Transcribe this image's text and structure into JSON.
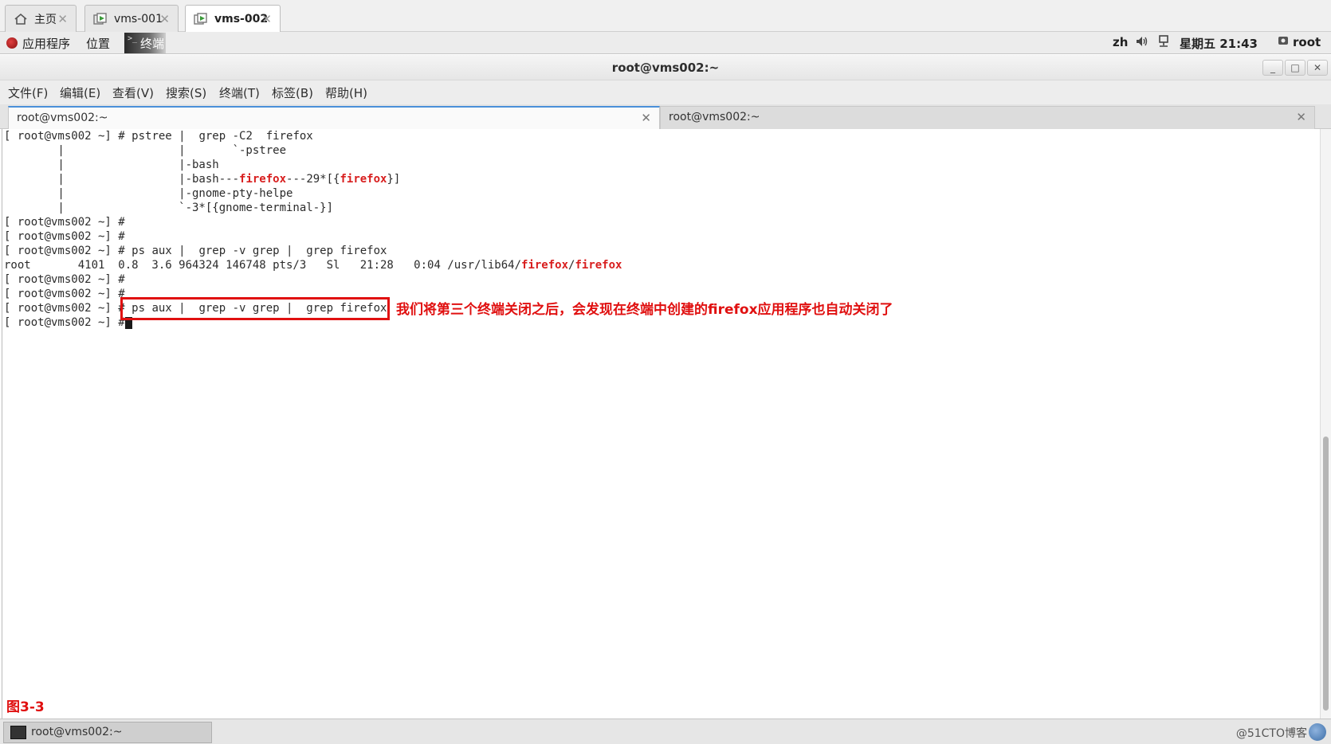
{
  "vm_tabs": [
    {
      "label": "主页",
      "icon": "home-icon",
      "active": false
    },
    {
      "label": "vms-001",
      "icon": "vm-icon",
      "active": false
    },
    {
      "label": "vms-002",
      "icon": "vm-icon",
      "active": true
    }
  ],
  "panel": {
    "applications": "应用程序",
    "places": "位置",
    "terminal": "终端",
    "input_method": "zh",
    "clock": "星期五 21:43",
    "user": "root"
  },
  "window": {
    "title": "root@vms002:~",
    "minimize": "_",
    "maximize": "□",
    "close": "✕"
  },
  "menu": [
    "文件(F)",
    "编辑(E)",
    "查看(V)",
    "搜索(S)",
    "终端(T)",
    "标签(B)",
    "帮助(H)"
  ],
  "terminal_tabs": [
    {
      "label": "root@vms002:~",
      "active": true
    },
    {
      "label": "root@vms002:~",
      "active": false
    }
  ],
  "terminal": {
    "prompt": "[ root@vms002 ~] # ",
    "lines": {
      "l1_cmd": "pstree |  grep -C2  firefox",
      "l2": "        |                 |       `-pstree",
      "l3": "        |                 |-bash",
      "l4_pre": "        |                 |-bash---",
      "l4_ff1": "firefox",
      "l4_mid": "---29*[{",
      "l4_ff2": "firefox",
      "l4_end": "}]",
      "l5": "        |                 |-gnome-pty-helpe",
      "l6": "        |                 `-3*[{gnome-terminal-}]",
      "l9_cmd": "ps aux |  grep -v grep |  grep firefox",
      "l10_pre": "root       4101  0.8  3.6 964324 146748 pts/3   Sl   21:28   0:04 /usr/lib64/",
      "l10_ff1": "firefox",
      "l10_sep": "/",
      "l10_ff2": "firefox",
      "l13_cmd": "ps aux |  grep -v grep |  grep firefox"
    }
  },
  "annotation": {
    "text": "我们将第三个终端关闭之后，会发现在终端中创建的firefox应用程序也自动关闭了",
    "figure_label": "图3-3",
    "color": "#e01010"
  },
  "taskbar": {
    "item": "root@vms002:~",
    "watermark": "@51CTO博客"
  }
}
